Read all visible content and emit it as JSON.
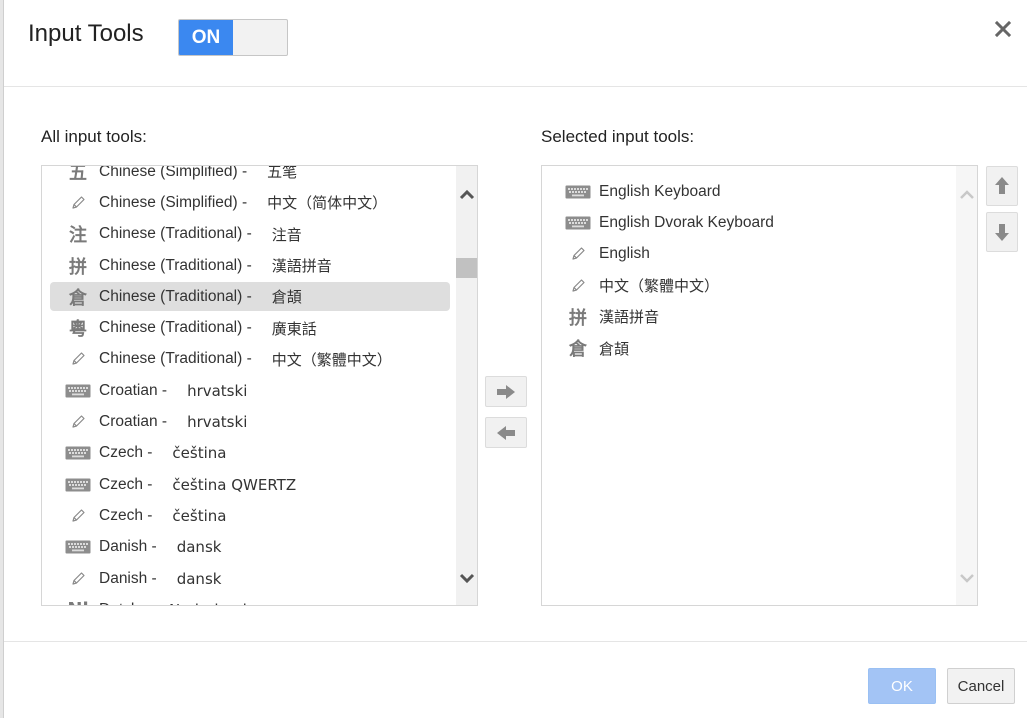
{
  "dialog": {
    "title": "Input Tools",
    "toggle_label": "ON",
    "toggle_state": "on",
    "close_icon": "close-icon"
  },
  "all_tools": {
    "label": "All input tools:",
    "items": [
      {
        "icon": "wubi-icon",
        "glyph": "五",
        "language": "Chinese (Simplified) -",
        "native": "五笔",
        "selected": false
      },
      {
        "icon": "pencil-icon",
        "glyph": "",
        "language": "Chinese (Simplified) -",
        "native": "中文（简体中文）",
        "selected": false
      },
      {
        "icon": "zhuyin-icon",
        "glyph": "注",
        "language": "Chinese (Traditional) -",
        "native": "注音",
        "selected": false
      },
      {
        "icon": "pinyin-icon",
        "glyph": "拼",
        "language": "Chinese (Traditional) -",
        "native": "漢語拼音",
        "selected": false
      },
      {
        "icon": "cangjie-icon",
        "glyph": "倉",
        "language": "Chinese (Traditional) -",
        "native": "倉頡",
        "selected": true
      },
      {
        "icon": "cantonese-icon",
        "glyph": "粵",
        "language": "Chinese (Traditional) -",
        "native": "廣東話",
        "selected": false
      },
      {
        "icon": "pencil-icon",
        "glyph": "",
        "language": "Chinese (Traditional) -",
        "native": "中文（繁體中文）",
        "selected": false
      },
      {
        "icon": "keyboard-icon",
        "glyph": "",
        "language": "Croatian -",
        "native": "hrvatski",
        "selected": false
      },
      {
        "icon": "pencil-icon",
        "glyph": "",
        "language": "Croatian -",
        "native": "hrvatski",
        "selected": false
      },
      {
        "icon": "keyboard-icon",
        "glyph": "",
        "language": "Czech -",
        "native": "čeština",
        "selected": false
      },
      {
        "icon": "keyboard-icon",
        "glyph": "",
        "language": "Czech -",
        "native": "čeština QWERTZ",
        "selected": false
      },
      {
        "icon": "pencil-icon",
        "glyph": "",
        "language": "Czech -",
        "native": "čeština",
        "selected": false
      },
      {
        "icon": "keyboard-icon",
        "glyph": "",
        "language": "Danish -",
        "native": "dansk",
        "selected": false
      },
      {
        "icon": "pencil-icon",
        "glyph": "",
        "language": "Danish -",
        "native": "dansk",
        "selected": false
      },
      {
        "icon": "dutch-icon",
        "glyph": "Nl",
        "language": "Dutch -",
        "native": "Nederlands",
        "selected": false
      }
    ]
  },
  "selected_tools": {
    "label": "Selected input tools:",
    "items": [
      {
        "icon": "keyboard-icon",
        "glyph": "",
        "label": "English Keyboard",
        "cjk": false
      },
      {
        "icon": "keyboard-icon",
        "glyph": "",
        "label": "English Dvorak Keyboard",
        "cjk": false
      },
      {
        "icon": "pencil-icon",
        "glyph": "",
        "label": "English",
        "cjk": false
      },
      {
        "icon": "pencil-icon",
        "glyph": "",
        "label": "中文（繁體中文）",
        "cjk": true
      },
      {
        "icon": "pinyin-icon",
        "glyph": "拼",
        "label": "漢語拼音",
        "cjk": true
      },
      {
        "icon": "cangjie-icon",
        "glyph": "倉",
        "label": "倉頡",
        "cjk": true
      }
    ]
  },
  "buttons": {
    "ok": "OK",
    "cancel": "Cancel",
    "add_icon": "arrow-right-icon",
    "remove_icon": "arrow-left-icon",
    "move_up_icon": "arrow-up-icon",
    "move_down_icon": "arrow-down-icon"
  },
  "colors": {
    "toggle_on": "#3b88f0",
    "ok_disabled": "#a3c4f5",
    "selected_row": "#dedede"
  }
}
